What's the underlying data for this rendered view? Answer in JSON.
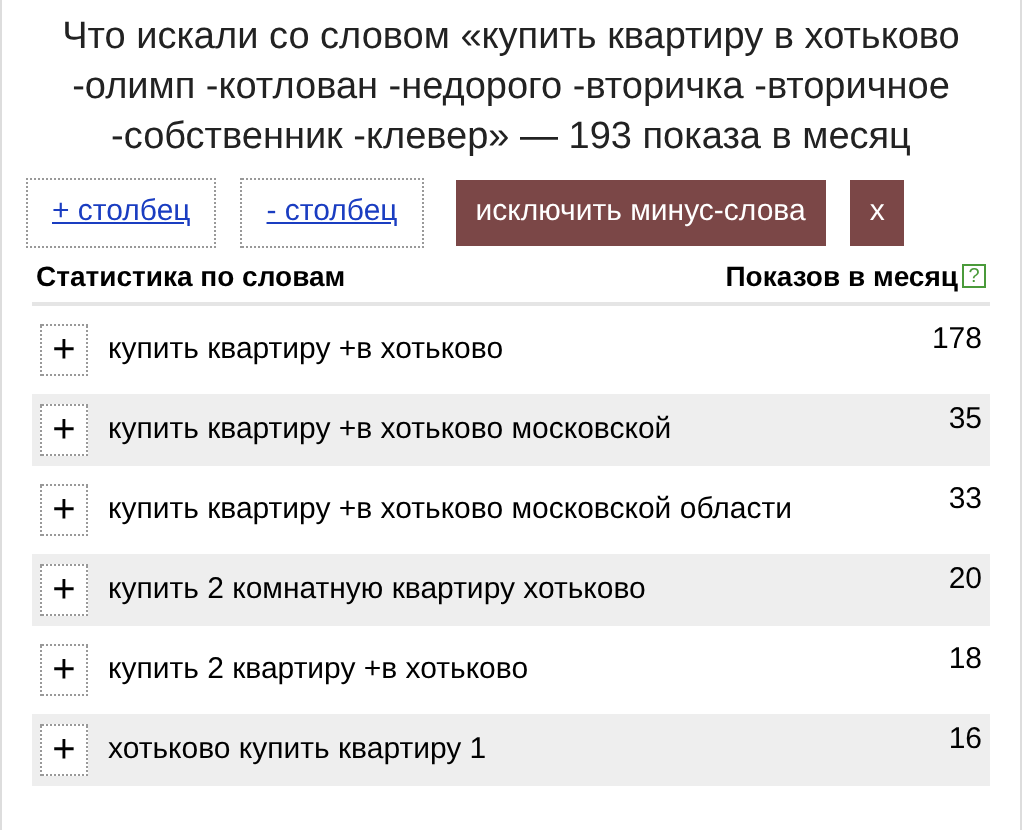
{
  "title": "Что искали со словом «купить квартиру в хотьково -олимп -котлован -недорого -вторичка -вторичное -собственник -клевер» — 193 показа в месяц",
  "buttons": [
    {
      "kind": "link",
      "label": "+ столбец"
    },
    {
      "kind": "link",
      "label": "- столбец"
    },
    {
      "kind": "solid",
      "label": "исключить минус-слова"
    },
    {
      "kind": "solid",
      "label": "x"
    }
  ],
  "table": {
    "columns": [
      "Статистика по словам",
      "Показов в месяц"
    ],
    "help": "?",
    "rows": [
      {
        "add": "+",
        "phrase": "купить квартиру +в хотьково",
        "count": "178"
      },
      {
        "add": "+",
        "phrase": "купить квартиру +в хотьково московской",
        "count": "35"
      },
      {
        "add": "+",
        "phrase": "купить квартиру +в хотьково московской области",
        "count": "33"
      },
      {
        "add": "+",
        "phrase": "купить 2 комнатную квартиру хотьково",
        "count": "20"
      },
      {
        "add": "+",
        "phrase": "купить 2 квартиру +в хотьково",
        "count": "18"
      },
      {
        "add": "+",
        "phrase": "хотьково купить квартиру 1",
        "count": "16"
      }
    ]
  }
}
